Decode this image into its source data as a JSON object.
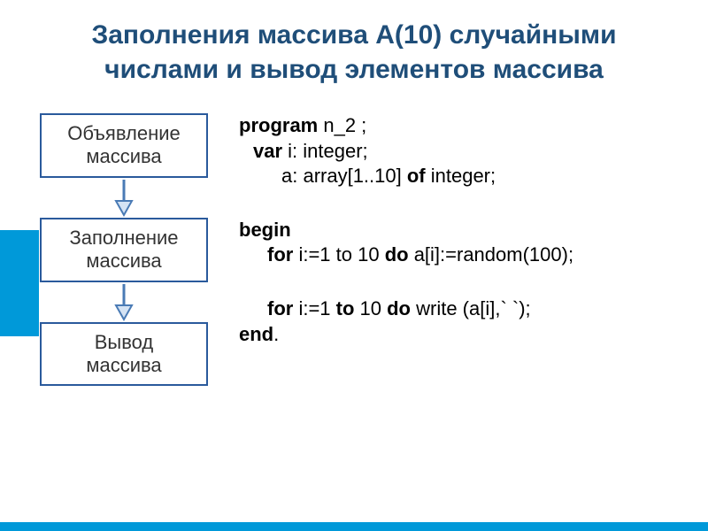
{
  "title_line1": "Заполнения массива А(10) случайными",
  "title_line2": "числами и вывод элементов массива",
  "boxes": {
    "declare_line1": "Объявление",
    "declare_line2": "массива",
    "fill_line1": "Заполнение",
    "fill_line2": "массива",
    "output_line1": "Вывод",
    "output_line2": "массива"
  },
  "code": {
    "line1a": "program",
    "line1b": "  n_2 ;",
    "line2a": "var",
    "line2b": " i: integer;",
    "line3a": "a: array[1..10] ",
    "line3b": "of",
    "line3c": " integer;",
    "line4": "begin",
    "line5a": "for",
    "line5b": " i:=1 to 10 ",
    "line5c": "do",
    "line5d": " a[i]:=random(100);",
    "line6a": "for",
    "line6b": " i:=1 ",
    "line6c": "to",
    "line6d": " 10 ",
    "line6e": "do",
    "line6f": " write (a[i],` `);",
    "line7": "end",
    "line7b": "."
  }
}
